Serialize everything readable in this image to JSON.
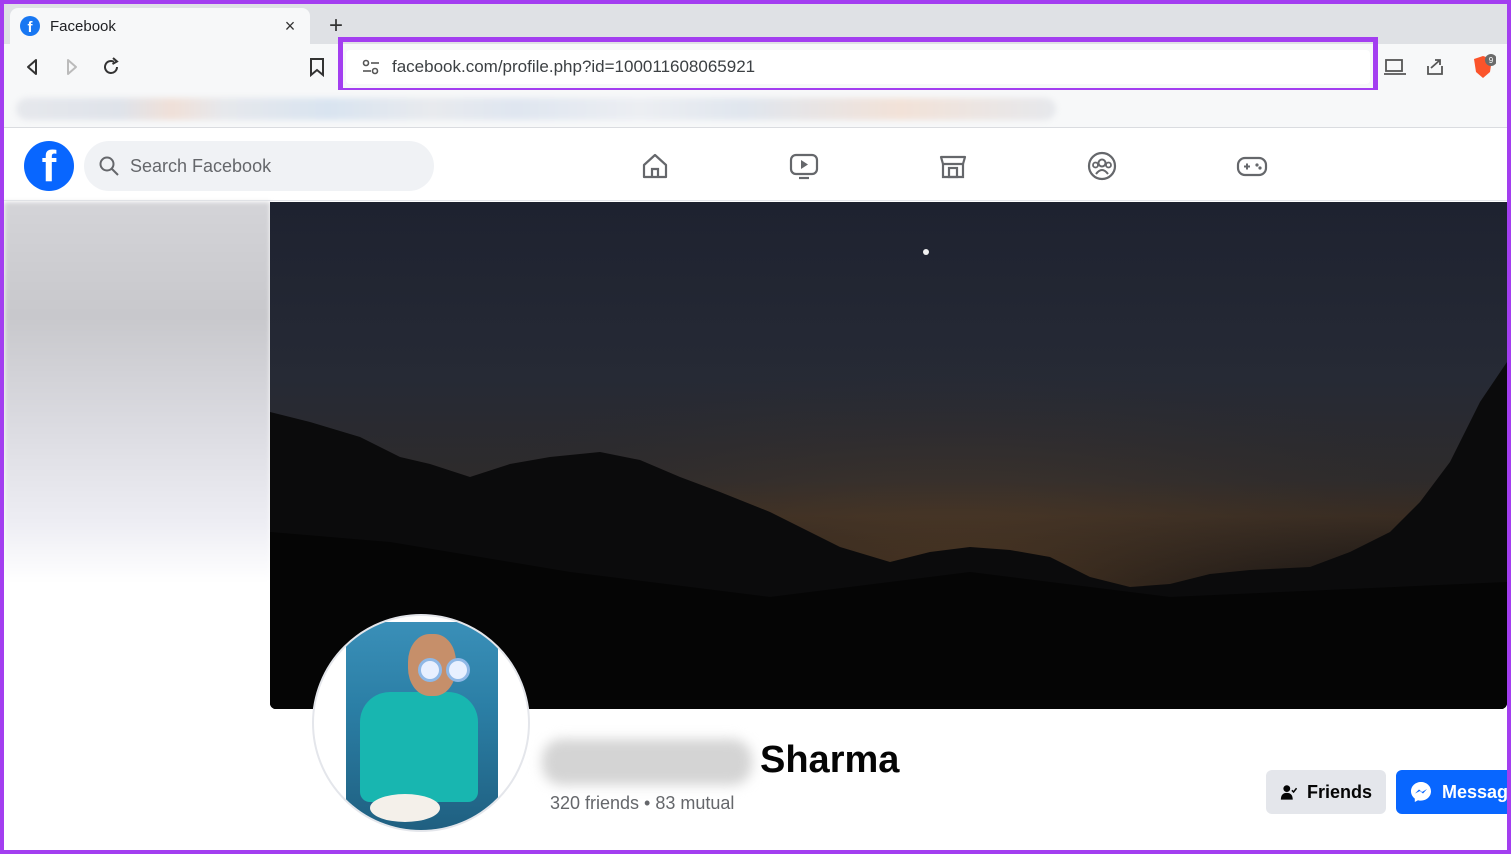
{
  "browser": {
    "tab_title": "Facebook",
    "tab_close": "×",
    "new_tab": "+",
    "url": "facebook.com/profile.php?id=100011608065921",
    "brave_badge": "9"
  },
  "facebook": {
    "logo_letter": "f",
    "search_placeholder": "Search Facebook",
    "nav": [
      "home-icon",
      "watch-icon",
      "marketplace-icon",
      "groups-icon",
      "gaming-icon"
    ]
  },
  "profile": {
    "surname": "Sharma",
    "friends_line": "320 friends • 83 mutual",
    "friends_button": "Friends",
    "message_button": "Message"
  },
  "colors": {
    "highlight": "#a33ef0",
    "fb_blue": "#0866ff"
  }
}
